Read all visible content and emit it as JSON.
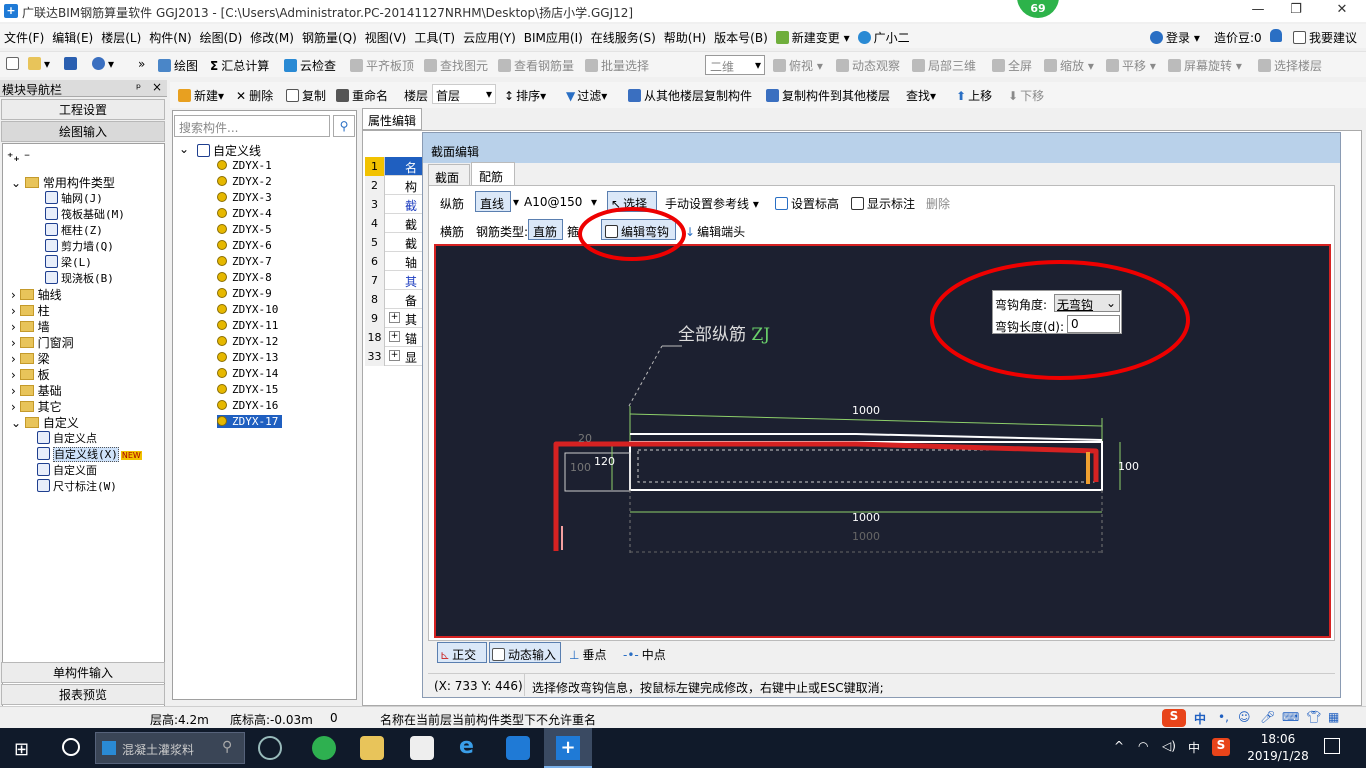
{
  "window": {
    "title": "广联达BIM钢筋算量软件 GGJ2013 - [C:\\Users\\Administrator.PC-20141127NRHM\\Desktop\\扬店小学.GGJ12]",
    "notification_count": "69",
    "minimize": "—",
    "maximize": "❐",
    "close": "✕"
  },
  "menu": {
    "items": [
      "文件(F)",
      "编辑(E)",
      "楼层(L)",
      "构件(N)",
      "绘图(D)",
      "修改(M)",
      "钢筋量(Q)",
      "视图(V)",
      "工具(T)",
      "云应用(Y)",
      "BIM应用(I)",
      "在线服务(S)",
      "帮助(H)",
      "版本号(B)",
      "新建变更",
      "广小二"
    ],
    "new_change_arrow": "▾",
    "login": "登录",
    "login_arrow": "▾",
    "price_beans": "造价豆:0",
    "suggest": "我要建议"
  },
  "toolbar1": {
    "draw": "绘图",
    "sum_calc": "汇总计算",
    "cloud_check": "云检查",
    "flat_top": "平齐板顶",
    "find_element": "查找图元",
    "view_rebar": "查看钢筋量",
    "batch_select": "批量选择",
    "view_mode": "二维",
    "top_view": "俯视",
    "dynamic_view": "动态观察",
    "local_3d": "局部三维",
    "fullscreen": "全屏",
    "zoom": "缩放",
    "pan": "平移",
    "screen_rotate": "屏幕旋转",
    "select_floor": "选择楼层"
  },
  "nav": {
    "title": "模块导航栏",
    "pin": "ᵖ",
    "close": "×",
    "project_settings": "工程设置",
    "draw_input": "绘图输入",
    "single_input": "单构件输入",
    "report_preview": "报表预览",
    "tree": [
      {
        "label": "常用构件类型",
        "kind": "folder-open"
      },
      {
        "label": "轴网(J)",
        "kind": "child"
      },
      {
        "label": "筏板基础(M)",
        "kind": "child"
      },
      {
        "label": "框柱(Z)",
        "kind": "child"
      },
      {
        "label": "剪力墙(Q)",
        "kind": "child"
      },
      {
        "label": "梁(L)",
        "kind": "child"
      },
      {
        "label": "现浇板(B)",
        "kind": "child"
      },
      {
        "label": "轴线",
        "kind": "folder"
      },
      {
        "label": "柱",
        "kind": "folder"
      },
      {
        "label": "墙",
        "kind": "folder"
      },
      {
        "label": "门窗洞",
        "kind": "folder"
      },
      {
        "label": "梁",
        "kind": "folder"
      },
      {
        "label": "板",
        "kind": "folder"
      },
      {
        "label": "基础",
        "kind": "folder"
      },
      {
        "label": "其它",
        "kind": "folder"
      },
      {
        "label": "自定义",
        "kind": "folder-open"
      },
      {
        "label": "自定义点",
        "kind": "child2"
      },
      {
        "label": "自定义线(X)",
        "kind": "child2-selected"
      },
      {
        "label": "自定义面",
        "kind": "child2"
      },
      {
        "label": "尺寸标注(W)",
        "kind": "child2"
      }
    ],
    "new_tag": "NEW"
  },
  "toolbar2": {
    "new": "新建",
    "delete": "删除",
    "copy": "复制",
    "rename": "重命名",
    "floor_label": "楼层",
    "floor_value": "首层",
    "sort": "排序",
    "filter": "过滤",
    "copy_from_other": "从其他楼层复制构件",
    "copy_to_other": "复制构件到其他楼层",
    "find": "查找",
    "move_up": "上移",
    "move_down": "下移"
  },
  "component_list": {
    "search_placeholder": "搜索构件...",
    "root": "自定义线",
    "items": [
      "ZDYX-1",
      "ZDYX-2",
      "ZDYX-3",
      "ZDYX-4",
      "ZDYX-5",
      "ZDYX-6",
      "ZDYX-7",
      "ZDYX-8",
      "ZDYX-9",
      "ZDYX-10",
      "ZDYX-11",
      "ZDYX-12",
      "ZDYX-13",
      "ZDYX-14",
      "ZDYX-15",
      "ZDYX-16",
      "ZDYX-17"
    ],
    "selected": "ZDYX-17"
  },
  "properties": {
    "tab": "属性编辑",
    "rows": [
      {
        "num": "1",
        "text": "名"
      },
      {
        "num": "2",
        "text": "构"
      },
      {
        "num": "3",
        "text": "截"
      },
      {
        "num": "4",
        "text": "截"
      },
      {
        "num": "5",
        "text": "截"
      },
      {
        "num": "6",
        "text": "轴"
      },
      {
        "num": "7",
        "text": "其"
      },
      {
        "num": "8",
        "text": "备"
      },
      {
        "num": "9",
        "text": "其"
      },
      {
        "num": "18",
        "text": "锚"
      },
      {
        "num": "33",
        "text": "显"
      }
    ],
    "expand": "+"
  },
  "dialog": {
    "title": "截面编辑",
    "tabs": [
      "截面",
      "配筋"
    ],
    "row1": {
      "long_rebar": "纵筋",
      "line": "直线",
      "spec": "A10@150",
      "select": "选择",
      "manual_ref": "手动设置参考线",
      "set_elevation": "设置标高",
      "show_annotation": "显示标注",
      "delete": "删除"
    },
    "row2": {
      "transverse": "横筋",
      "rebar_type_label": "钢筋类型:",
      "straight": "直筋",
      "stirrup": "箍",
      "edit_hook": "编辑弯钩",
      "edit_end": "编辑端头"
    },
    "hook_angle_label": "弯钩角度:",
    "hook_angle_value": "无弯钩",
    "hook_length_label": "弯钩长度(d):",
    "hook_length_value": "0",
    "rebar_label": "全部纵筋",
    "rebar_code": "ZJ",
    "dimensions": {
      "top": "1000",
      "bottom": "1000",
      "bottom_gray": "1000",
      "right": "100",
      "left_120": "120",
      "left_100": "100",
      "left_20": "20"
    },
    "bottom": {
      "ortho": "正交",
      "dyn_input": "动态输入",
      "perpendicular": "垂点",
      "midpoint": "中点"
    },
    "coords": "(X: 733 Y: 446)",
    "hint": "选择修改弯钩信息，按鼠标左键完成修改，右键中止或ESC键取消;"
  },
  "statusbar": {
    "floor_height": "层高:4.2m",
    "bottom_elev": "底标高:-0.03m",
    "zero": "0",
    "message": "名称在当前层当前构件类型下不允许重名"
  },
  "taskbar": {
    "search_text": "混凝土灌浆料",
    "ime": "中",
    "time": "18:06",
    "date": "2019/1/28",
    "tray_ime": "中"
  }
}
